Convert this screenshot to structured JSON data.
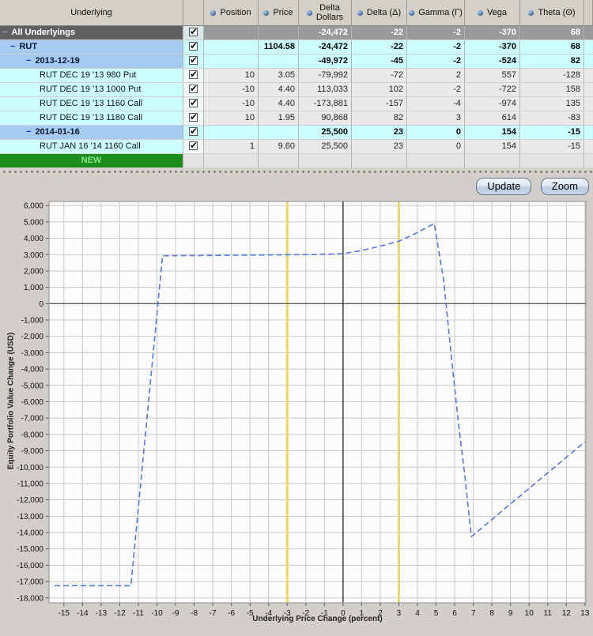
{
  "table": {
    "columns": [
      {
        "key": "underlying",
        "label": "Underlying",
        "bullet": false
      },
      {
        "key": "check",
        "label": "",
        "bullet": false
      },
      {
        "key": "position",
        "label": "Position",
        "bullet": true
      },
      {
        "key": "price",
        "label": "Price",
        "bullet": true
      },
      {
        "key": "delta_dollars",
        "label": "Delta\nDollars",
        "bullet": true
      },
      {
        "key": "delta",
        "label": "Delta (Δ)",
        "bullet": true
      },
      {
        "key": "gamma",
        "label": "Gamma (Γ)",
        "bullet": true
      },
      {
        "key": "vega",
        "label": "Vega",
        "bullet": true
      },
      {
        "key": "theta",
        "label": "Theta (Θ)",
        "bullet": true
      },
      {
        "key": "sliver",
        "label": "",
        "bullet": false
      }
    ],
    "rows": [
      {
        "label": "All Underlyings",
        "type": "total",
        "indent": 3,
        "collapsible": true,
        "checked": true,
        "position": "",
        "price": "",
        "delta_dollars": "-24,472",
        "delta": "-22",
        "gamma": "-2",
        "vega": "-370",
        "theta": "68"
      },
      {
        "label": "RUT",
        "type": "group",
        "indent": 13,
        "collapsible": true,
        "checked": true,
        "position": "",
        "price": "1104.58",
        "delta_dollars": "-24,472",
        "delta": "-22",
        "gamma": "-2",
        "vega": "-370",
        "theta": "68"
      },
      {
        "label": "2013-12-19",
        "type": "group",
        "indent": 33,
        "collapsible": true,
        "checked": true,
        "position": "",
        "price": "",
        "delta_dollars": "-49,972",
        "delta": "-45",
        "gamma": "-2",
        "vega": "-524",
        "theta": "82"
      },
      {
        "label": "RUT DEC 19 '13 980 Put",
        "type": "option",
        "indent": 50,
        "collapsible": false,
        "checked": true,
        "position": "10",
        "price": "3.05",
        "delta_dollars": "-79,992",
        "delta": "-72",
        "gamma": "2",
        "vega": "557",
        "theta": "-128"
      },
      {
        "label": "RUT DEC 19 '13 1000 Put",
        "type": "option",
        "indent": 50,
        "collapsible": false,
        "checked": true,
        "position": "-10",
        "price": "4.40",
        "delta_dollars": "113,033",
        "delta": "102",
        "gamma": "-2",
        "vega": "-722",
        "theta": "158"
      },
      {
        "label": "RUT DEC 19 '13 1160 Call",
        "type": "option",
        "indent": 50,
        "collapsible": false,
        "checked": true,
        "position": "-10",
        "price": "4.40",
        "delta_dollars": "-173,881",
        "delta": "-157",
        "gamma": "-4",
        "vega": "-974",
        "theta": "135"
      },
      {
        "label": "RUT DEC 19 '13 1180 Call",
        "type": "option",
        "indent": 50,
        "collapsible": false,
        "checked": true,
        "position": "10",
        "price": "1.95",
        "delta_dollars": "90,868",
        "delta": "82",
        "gamma": "3",
        "vega": "614",
        "theta": "-83"
      },
      {
        "label": "2014-01-16",
        "type": "group",
        "indent": 33,
        "collapsible": true,
        "checked": true,
        "position": "",
        "price": "",
        "delta_dollars": "25,500",
        "delta": "23",
        "gamma": "0",
        "vega": "154",
        "theta": "-15"
      },
      {
        "label": "RUT JAN 16 '14 1160 Call",
        "type": "option",
        "indent": 50,
        "collapsible": false,
        "checked": true,
        "position": "1",
        "price": "9.60",
        "delta_dollars": "25,500",
        "delta": "23",
        "gamma": "0",
        "vega": "154",
        "theta": "-15"
      },
      {
        "label": "NEW",
        "type": "new",
        "indent": 0,
        "collapsible": false,
        "checked": false,
        "position": "",
        "price": "",
        "delta_dollars": "",
        "delta": "",
        "gamma": "",
        "vega": "",
        "theta": ""
      }
    ]
  },
  "buttons": {
    "update": "Update",
    "zoom": "Zoom"
  },
  "chart_data": {
    "type": "line",
    "title": "",
    "xlabel": "Underlying Price Change (percent)",
    "ylabel": "Equity Portfolio Value Change (USD)",
    "x_range": [
      -15.8,
      13.05
    ],
    "y_range": [
      -18300,
      6250
    ],
    "x_ticks": [
      -15,
      -14,
      -13,
      -12,
      -11,
      -10,
      -9,
      -8,
      -7,
      -6,
      -5,
      -4,
      -3,
      -2,
      -1,
      0,
      1,
      2,
      3,
      4,
      5,
      6,
      7,
      8,
      9,
      10,
      11,
      12,
      13
    ],
    "y_ticks": [
      6000,
      5000,
      4000,
      3000,
      2000,
      1000,
      0,
      -1000,
      -2000,
      -3000,
      -4000,
      -5000,
      -6000,
      -7000,
      -8000,
      -9000,
      -10000,
      -11000,
      -12000,
      -13000,
      -14000,
      -15000,
      -16000,
      -17000,
      -18000
    ],
    "grid": true,
    "legend": "none",
    "reference_lines": {
      "vertical_yellow": [
        -3,
        3
      ],
      "vertical_black": [
        0
      ],
      "horizontal_black": [
        0
      ]
    },
    "series": [
      {
        "name": "equity-pl-curve",
        "style": "dashed",
        "color": "#5578dd",
        "points": [
          [
            -15.5,
            -17250
          ],
          [
            -11.4,
            -17250
          ],
          [
            -9.7,
            2930
          ],
          [
            -7,
            2950
          ],
          [
            -4,
            2980
          ],
          [
            -2,
            3000
          ],
          [
            -1,
            3020
          ],
          [
            0,
            3060
          ],
          [
            1,
            3250
          ],
          [
            2,
            3520
          ],
          [
            3,
            3820
          ],
          [
            4,
            4350
          ],
          [
            4.9,
            4900
          ],
          [
            5.4,
            1500
          ],
          [
            5.8,
            -3000
          ],
          [
            6.2,
            -7300
          ],
          [
            6.5,
            -10100
          ],
          [
            6.9,
            -14250
          ],
          [
            13,
            -8450
          ]
        ]
      }
    ]
  },
  "colors": {
    "row_total_bg": "#606060",
    "row_group_label_bg": "#a6cbf2",
    "row_data_cyan": "#ccffff",
    "row_option_gray": "#e9e9e9",
    "row_new_green": "#1b8e1b",
    "header_bg": "#d4d0c8",
    "series_blue": "#5578dd",
    "reference_yellow": "#ead964"
  }
}
